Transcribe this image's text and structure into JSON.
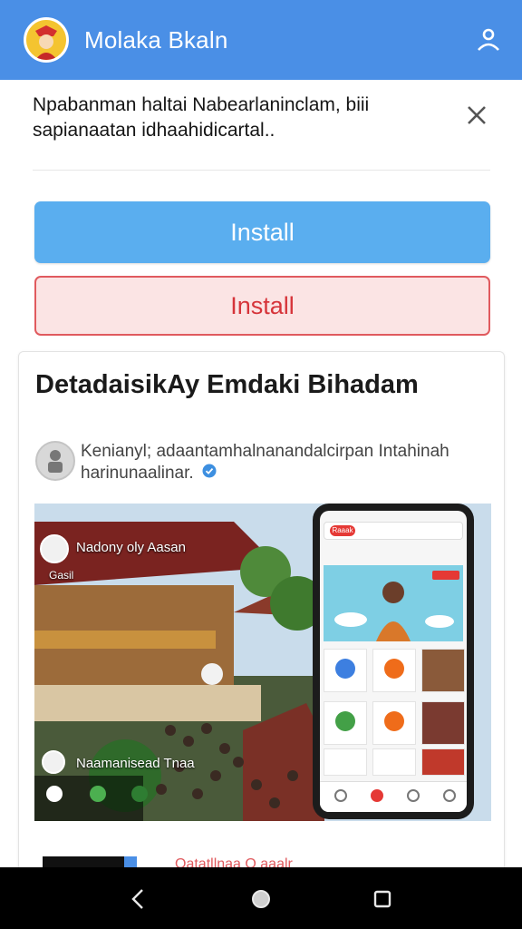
{
  "appbar": {
    "title": "Molaka Bkaln",
    "bg_color": "#4a8fe6",
    "avatar_icon": "app-avatar-icon",
    "account_icon": "person-icon"
  },
  "banner": {
    "text": "Npabanman haltai Nabearlaninclam, biii sapianaatan idhaahidicartal..",
    "close_icon": "close-icon"
  },
  "buttons": {
    "install_primary": "Install",
    "install_secondary": "Install",
    "primary_color": "#5aaeef",
    "secondary_color": "#d6343a"
  },
  "card": {
    "title": "DetadaisikAy Emdaki Bihadam",
    "author_text": "Kenianyl; adaantamhalnanandalcirpan  Intahinah harinunaalinar.",
    "media": {
      "label_top": "Nadony oly Aasan",
      "sublabel": "Gasil",
      "label_bottom": "Naamanisead Tnaa",
      "phone_logo": "Raaak"
    },
    "footer_text": "Oatatllnaa    O  aaalr"
  },
  "navbar": {
    "back_icon": "back-icon",
    "home_icon": "home-icon",
    "recents_icon": "recents-icon"
  }
}
